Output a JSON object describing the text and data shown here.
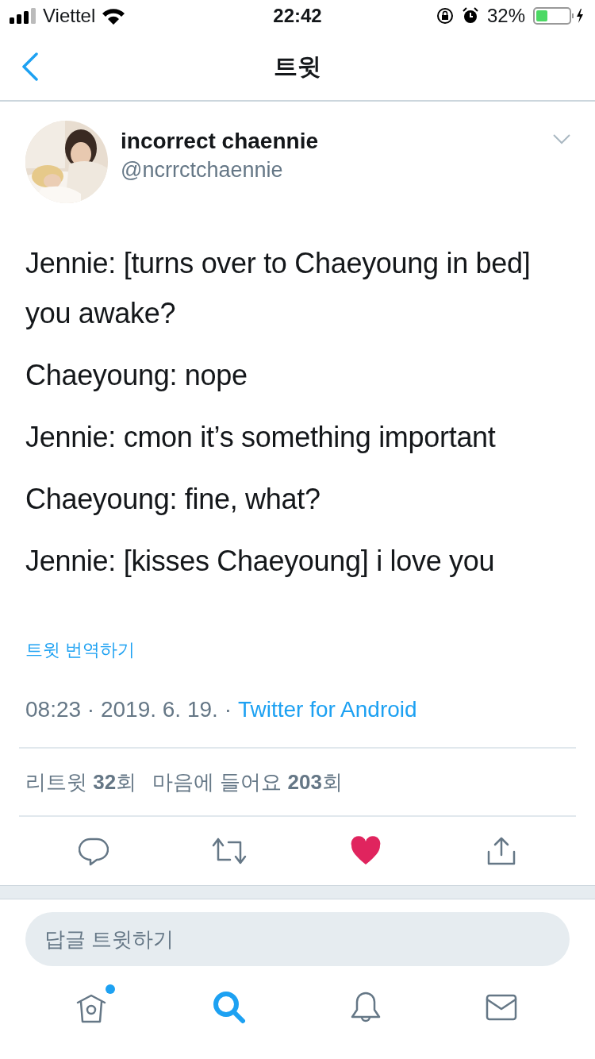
{
  "status_bar": {
    "carrier": "Viettel",
    "time": "22:42",
    "battery": "32%"
  },
  "header": {
    "title": "트윗"
  },
  "tweet": {
    "name": "incorrect chaennie",
    "handle": "@ncrrctchaennie",
    "paragraphs": [
      "Jennie: [turns over to Chaeyoung in bed] you awake?",
      "Chaeyoung: nope",
      "Jennie: cmon it’s something important",
      "Chaeyoung: fine, what?",
      "Jennie: [kisses Chaeyoung] i love you"
    ],
    "translate": "트윗 번역하기",
    "date": "08:23 · 2019. 6. 19. ·",
    "source": "Twitter for Android",
    "stats": [
      "리트윗 **32**회",
      "마음에 들어요 **203**회"
    ],
    "actions": [
      {
        "kind": "reply"
      },
      {
        "kind": "retweet"
      },
      {
        "kind": "like",
        "liked": true
      },
      {
        "kind": "share"
      }
    ]
  },
  "reply_field": {
    "placeholder": "답글 트윗하기"
  },
  "tabs": [
    {
      "kind": "home",
      "selected": false,
      "dot": true
    },
    {
      "kind": "search",
      "selected": true,
      "dot": false
    },
    {
      "kind": "notifications",
      "selected": false,
      "dot": false
    },
    {
      "kind": "messages",
      "selected": false,
      "dot": false
    }
  ]
}
